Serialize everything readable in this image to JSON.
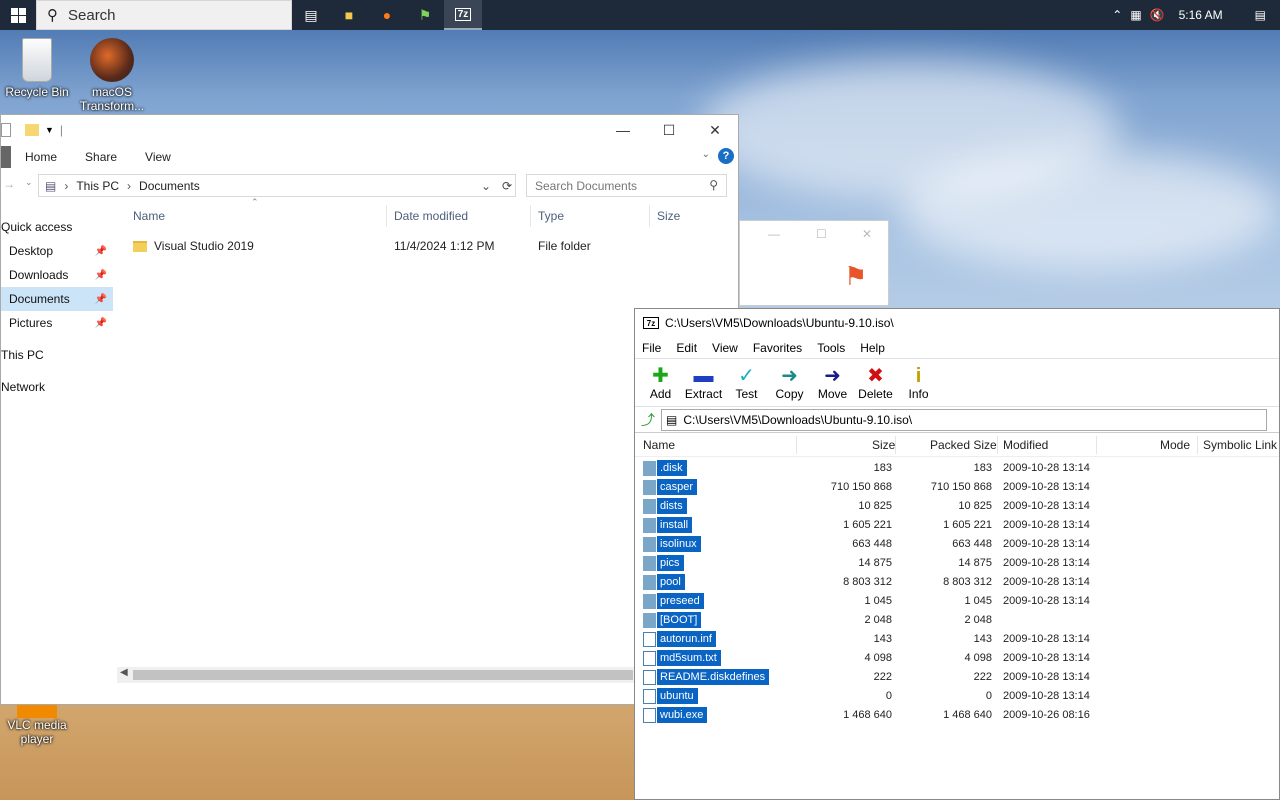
{
  "taskbar": {
    "search_placeholder": "Search",
    "time": "5:16 AM"
  },
  "desktop": {
    "icons": [
      {
        "label": "Recycle Bin"
      },
      {
        "label": "macOS Transform..."
      },
      {
        "label": "VLC media player"
      }
    ]
  },
  "explorer": {
    "ribbon_tabs": [
      "Home",
      "Share",
      "View"
    ],
    "breadcrumb": [
      "This PC",
      "Documents"
    ],
    "search_placeholder": "Search Documents",
    "nav": {
      "quick_access": "Quick access",
      "items": [
        "Desktop",
        "Downloads",
        "Documents",
        "Pictures"
      ],
      "this_pc": "This PC",
      "network": "Network"
    },
    "columns": [
      "Name",
      "Date modified",
      "Type",
      "Size"
    ],
    "rows": [
      {
        "name": "Visual Studio 2019",
        "date": "11/4/2024 1:12 PM",
        "type": "File folder",
        "size": ""
      }
    ]
  },
  "zip": {
    "title": "C:\\Users\\VM5\\Downloads\\Ubuntu-9.10.iso\\",
    "menu": [
      "File",
      "Edit",
      "View",
      "Favorites",
      "Tools",
      "Help"
    ],
    "tools": [
      {
        "label": "Add",
        "icon": "add-icon",
        "color": "#1aa81a"
      },
      {
        "label": "Extract",
        "icon": "extract-icon",
        "color": "#1e3fbf"
      },
      {
        "label": "Test",
        "icon": "test-icon",
        "color": "#1aaec0"
      },
      {
        "label": "Copy",
        "icon": "copy-icon",
        "color": "#1a8a8a"
      },
      {
        "label": "Move",
        "icon": "move-icon",
        "color": "#1a1a8a"
      },
      {
        "label": "Delete",
        "icon": "delete-icon",
        "color": "#d01010"
      },
      {
        "label": "Info",
        "icon": "info-icon",
        "color": "#c0a000"
      }
    ],
    "path": "C:\\Users\\VM5\\Downloads\\Ubuntu-9.10.iso\\",
    "columns": [
      "Name",
      "Size",
      "Packed Size",
      "Modified",
      "Mode",
      "Symbolic Link"
    ],
    "files": [
      {
        "name": ".disk",
        "size": "183",
        "packed": "183",
        "modified": "2009-10-28 13:14",
        "kind": "folder"
      },
      {
        "name": "casper",
        "size": "710 150 868",
        "packed": "710 150 868",
        "modified": "2009-10-28 13:14",
        "kind": "folder"
      },
      {
        "name": "dists",
        "size": "10 825",
        "packed": "10 825",
        "modified": "2009-10-28 13:14",
        "kind": "folder"
      },
      {
        "name": "install",
        "size": "1 605 221",
        "packed": "1 605 221",
        "modified": "2009-10-28 13:14",
        "kind": "folder"
      },
      {
        "name": "isolinux",
        "size": "663 448",
        "packed": "663 448",
        "modified": "2009-10-28 13:14",
        "kind": "folder"
      },
      {
        "name": "pics",
        "size": "14 875",
        "packed": "14 875",
        "modified": "2009-10-28 13:14",
        "kind": "folder"
      },
      {
        "name": "pool",
        "size": "8 803 312",
        "packed": "8 803 312",
        "modified": "2009-10-28 13:14",
        "kind": "folder"
      },
      {
        "name": "preseed",
        "size": "1 045",
        "packed": "1 045",
        "modified": "2009-10-28 13:14",
        "kind": "folder"
      },
      {
        "name": "[BOOT]",
        "size": "2 048",
        "packed": "2 048",
        "modified": "",
        "kind": "folder"
      },
      {
        "name": "autorun.inf",
        "size": "143",
        "packed": "143",
        "modified": "2009-10-28 13:14",
        "kind": "file"
      },
      {
        "name": "md5sum.txt",
        "size": "4 098",
        "packed": "4 098",
        "modified": "2009-10-28 13:14",
        "kind": "file"
      },
      {
        "name": "README.diskdefines",
        "size": "222",
        "packed": "222",
        "modified": "2009-10-28 13:14",
        "kind": "file"
      },
      {
        "name": "ubuntu",
        "size": "0",
        "packed": "0",
        "modified": "2009-10-28 13:14",
        "kind": "file"
      },
      {
        "name": "wubi.exe",
        "size": "1 468 640",
        "packed": "1 468 640",
        "modified": "2009-10-26 08:16",
        "kind": "file"
      }
    ]
  }
}
